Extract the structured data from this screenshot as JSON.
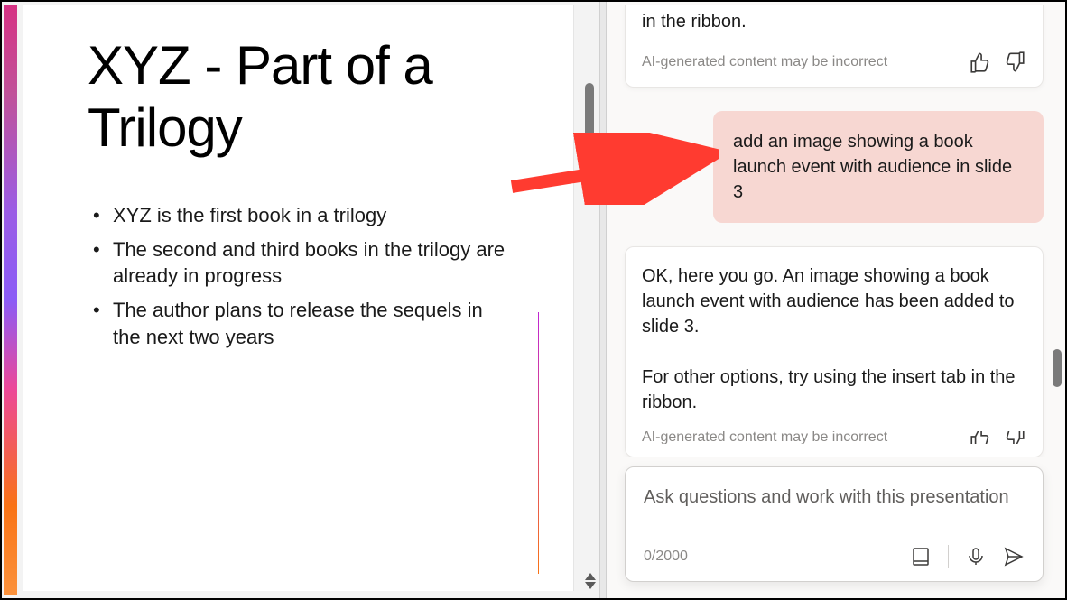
{
  "slide": {
    "title": "XYZ - Part of a Trilogy",
    "bullets": [
      "XYZ is the first book in a trilogy",
      "The second and third books in the trilogy are already in progress",
      "The author plans to release the sequels in the next two years"
    ]
  },
  "chat": {
    "messages": [
      {
        "role": "assistant",
        "text_fragment": "in the ribbon.",
        "disclaimer": "AI-generated content may be incorrect"
      },
      {
        "role": "user",
        "text": "add an image showing a book launch event with audience in slide 3"
      },
      {
        "role": "assistant",
        "text_p1": "OK, here you go. An image showing a book launch event with audience has been added to slide 3.",
        "text_p2": "For other options, try using the insert tab in the ribbon.",
        "disclaimer": "AI-generated content may be incorrect"
      }
    ]
  },
  "input": {
    "placeholder": "Ask questions and work with this presentation",
    "char_count": "0/2000"
  },
  "icons": {
    "thumbs_up": "thumbs-up-icon",
    "thumbs_down": "thumbs-down-icon",
    "book": "book-icon",
    "mic": "microphone-icon",
    "send": "send-icon"
  },
  "colors": {
    "user_bubble": "#f7d7d2",
    "panel_bg": "#faf9f8",
    "arrow": "#ff3b30"
  }
}
